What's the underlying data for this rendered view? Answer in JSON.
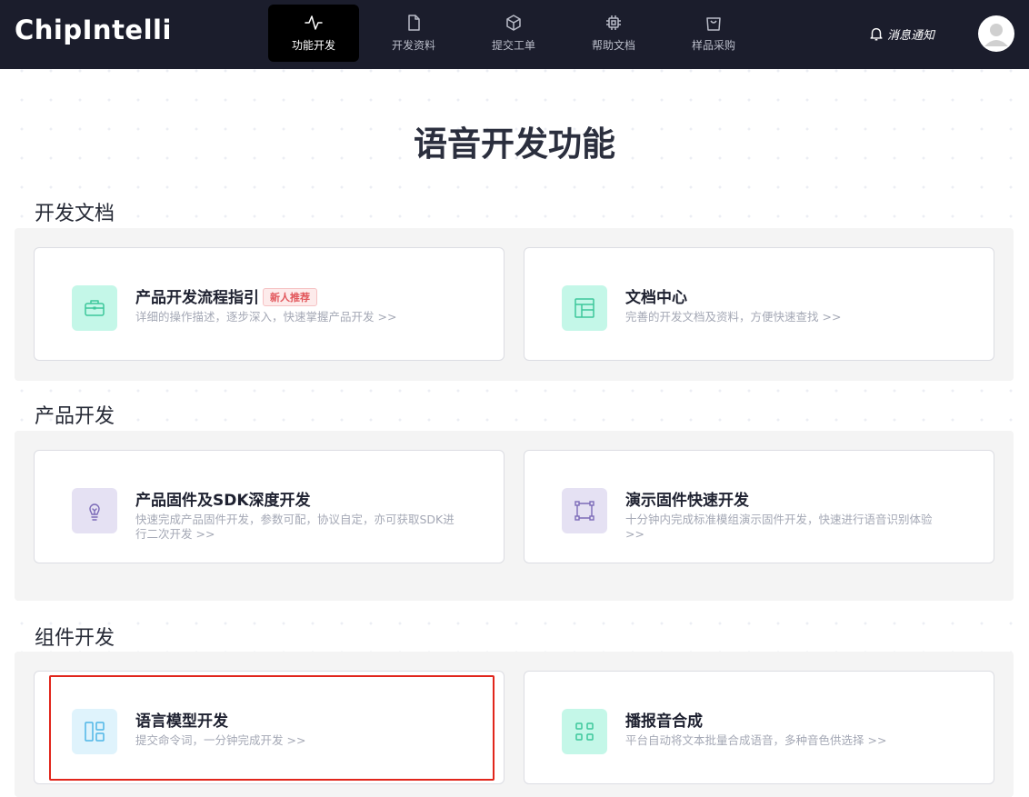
{
  "header": {
    "logo": "ChipIntelli",
    "nav": [
      {
        "label": "功能开发",
        "icon": "pulse-icon"
      },
      {
        "label": "开发资料",
        "icon": "document-icon"
      },
      {
        "label": "提交工单",
        "icon": "cube-icon"
      },
      {
        "label": "帮助文档",
        "icon": "chip-icon"
      },
      {
        "label": "样品采购",
        "icon": "shopping-bag-icon"
      }
    ],
    "active_nav": "功能开发",
    "notify_label": "消息通知",
    "notify_icon": "bell-icon",
    "avatar_icon": "user-icon"
  },
  "page_title": "语音开发功能",
  "sections": [
    {
      "title": "开发文档",
      "cards": [
        {
          "title": "产品开发流程指引",
          "badge": "新人推荐",
          "desc": "详细的操作描述，逐步深入，快速掌握产品开发 >>",
          "icon": "briefcase-icon",
          "icon_bg": "#c4f7e8",
          "icon_color": "#3cc79a"
        },
        {
          "title": "文档中心",
          "desc": "完善的开发文档及资料，方便快速查找 >>",
          "icon": "layout-icon",
          "icon_bg": "#c4f7e8",
          "icon_color": "#3cc79a"
        }
      ]
    },
    {
      "title": "产品开发",
      "cards": [
        {
          "title": "产品固件及SDK深度开发",
          "desc": "快速完成产品固件开发，参数可配，协议自定，亦可获取SDK进行二次开发 >>",
          "icon": "lightbulb-icon",
          "icon_bg": "#e5e1f3",
          "icon_color": "#7c6bb8"
        },
        {
          "title": "演示固件快速开发",
          "desc": "十分钟内完成标准模组演示固件开发，快速进行语音识别体验 >>",
          "icon": "frame-icon",
          "icon_bg": "#e5e1f3",
          "icon_color": "#7c6bb8"
        }
      ]
    },
    {
      "title": "组件开发",
      "cards": [
        {
          "title": "语言模型开发",
          "desc": "提交命令词，一分钟完成开发 >>",
          "icon": "columns-icon",
          "icon_bg": "#dff3fc",
          "icon_color": "#4fb6e6"
        },
        {
          "title": "播报音合成",
          "desc": "平台自动将文本批量合成语音，多种音色供选择 >>",
          "icon": "grid-icon",
          "icon_bg": "#c4f7e8",
          "icon_color": "#3cc79a"
        }
      ]
    }
  ],
  "highlighted_card": "语言模型开发",
  "highlight_color": "#e1261c"
}
